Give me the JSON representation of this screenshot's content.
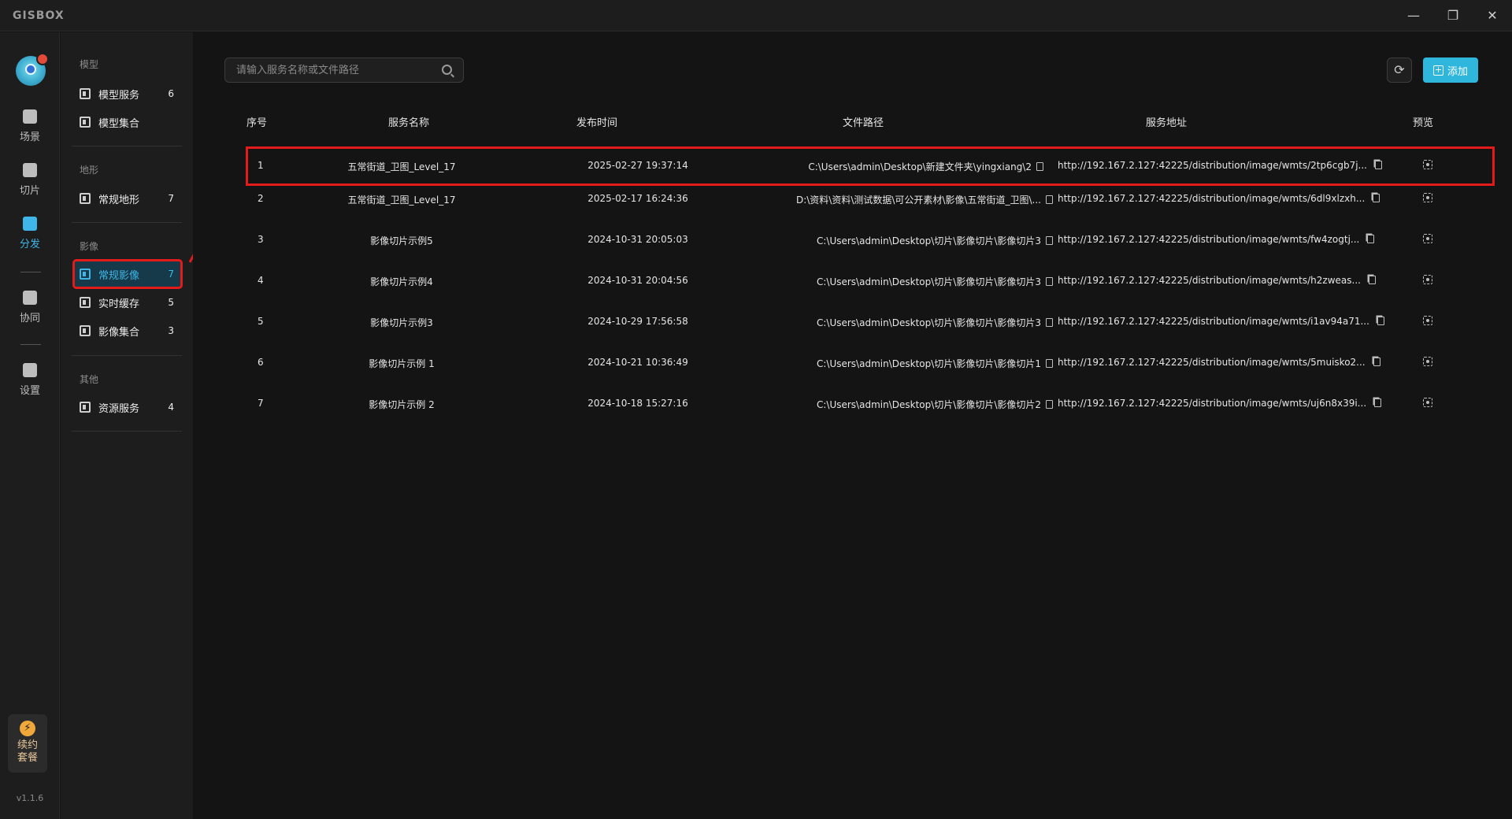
{
  "app": {
    "logo": "GISBOX",
    "window_buttons": {
      "minimize": "—",
      "restore": "❐",
      "close": "✕"
    }
  },
  "rail": {
    "items": [
      {
        "label": "场景",
        "icon": "scene-icon"
      },
      {
        "label": "切片",
        "icon": "tile-icon"
      },
      {
        "label": "分发",
        "icon": "publish-icon",
        "active": true
      },
      {
        "label": "协同",
        "icon": "collab-icon"
      },
      {
        "label": "设置",
        "icon": "settings-icon"
      }
    ],
    "renew_line1": "续约",
    "renew_line2": "套餐",
    "version": "v1.1.6"
  },
  "sidebar": {
    "sections": [
      {
        "title": "模型",
        "items": [
          {
            "label": "模型服务",
            "count": "6"
          },
          {
            "label": "模型集合",
            "count": ""
          }
        ]
      },
      {
        "title": "地形",
        "items": [
          {
            "label": "常规地形",
            "count": "7"
          }
        ]
      },
      {
        "title": "影像",
        "items": [
          {
            "label": "常规影像",
            "count": "7",
            "active": true
          },
          {
            "label": "实时缓存",
            "count": "5"
          },
          {
            "label": "影像集合",
            "count": "3"
          }
        ]
      },
      {
        "title": "其他",
        "items": [
          {
            "label": "资源服务",
            "count": "4"
          }
        ]
      }
    ]
  },
  "toolbar": {
    "search_placeholder": "请输入服务名称或文件路径",
    "add_label": "添加"
  },
  "table": {
    "headers": [
      "序号",
      "服务名称",
      "发布时间",
      "文件路径",
      "服务地址",
      "预览"
    ],
    "rows": [
      {
        "idx": "1",
        "name": "五常街道_卫图_Level_17",
        "time": "2025-02-27 19:37:14",
        "path": "C:\\Users\\admin\\Desktop\\新建文件夹\\yingxiang\\2",
        "url": "http://192.167.2.127:42225/distribution/image/wmts/2tp6cgb7j..."
      },
      {
        "idx": "2",
        "name": "五常街道_卫图_Level_17",
        "time": "2025-02-17 16:24:36",
        "path": "D:\\资料\\资料\\测试数据\\可公开素材\\影像\\五常街道_卫图\\...",
        "url": "http://192.167.2.127:42225/distribution/image/wmts/6dl9xlzxh..."
      },
      {
        "idx": "3",
        "name": "影像切片示例5",
        "time": "2024-10-31 20:05:03",
        "path": "C:\\Users\\admin\\Desktop\\切片\\影像切片\\影像切片3",
        "url": "http://192.167.2.127:42225/distribution/image/wmts/fw4zogtj..."
      },
      {
        "idx": "4",
        "name": "影像切片示例4",
        "time": "2024-10-31 20:04:56",
        "path": "C:\\Users\\admin\\Desktop\\切片\\影像切片\\影像切片3",
        "url": "http://192.167.2.127:42225/distribution/image/wmts/h2zweas..."
      },
      {
        "idx": "5",
        "name": "影像切片示例3",
        "time": "2024-10-29 17:56:58",
        "path": "C:\\Users\\admin\\Desktop\\切片\\影像切片\\影像切片3",
        "url": "http://192.167.2.127:42225/distribution/image/wmts/i1av94a71..."
      },
      {
        "idx": "6",
        "name": "影像切片示例 1",
        "time": "2024-10-21 10:36:49",
        "path": "C:\\Users\\admin\\Desktop\\切片\\影像切片\\影像切片1",
        "url": "http://192.167.2.127:42225/distribution/image/wmts/5muisko2..."
      },
      {
        "idx": "7",
        "name": "影像切片示例 2",
        "time": "2024-10-18 15:27:16",
        "path": "C:\\Users\\admin\\Desktop\\切片\\影像切片\\影像切片2",
        "url": "http://192.167.2.127:42225/distribution/image/wmts/uj6n8x39i..."
      }
    ]
  },
  "colors": {
    "accent": "#2fb6dc",
    "highlight": "#e31b1b",
    "background": "#141414",
    "panel": "#1d1d1d"
  }
}
